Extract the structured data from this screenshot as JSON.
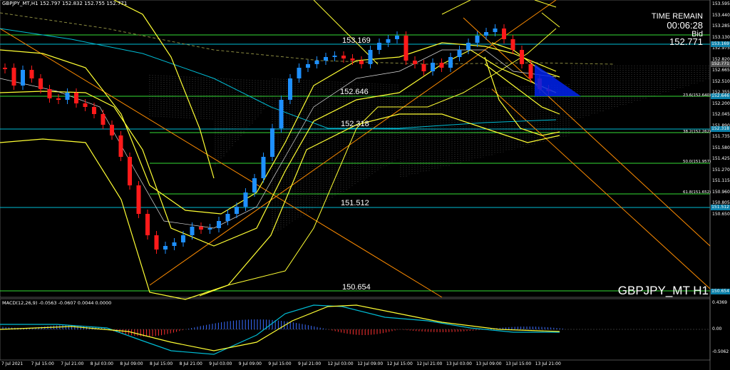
{
  "info_line": "GBPJPY_MT,H1  152.797 152.832 152.755 152.771",
  "macd_label": "MACD(12,26,9) -0.0563 -0.0607 0.0044 0.0000",
  "time_remain": {
    "label": "TIME REMAIN",
    "value": "00:06:28"
  },
  "bid": {
    "label": "Bid",
    "value": "152.771"
  },
  "symbol_label": "GBPJPY_MT H1",
  "levels": [
    "153.169",
    "152.646",
    "152.318",
    "151.512",
    "150.654"
  ],
  "fib_labels": [
    "23.6(152.640)",
    "38.2(152.262)",
    "50.0(151.957)",
    "61.8(151.652)"
  ],
  "price_ticks": [
    "153.595",
    "153.440",
    "153.285",
    "153.130",
    "152.975",
    "152.820",
    "152.665",
    "152.510",
    "152.355",
    "152.200",
    "152.045",
    "151.890",
    "151.735",
    "151.580",
    "151.425",
    "151.270",
    "151.115",
    "150.960",
    "150.805",
    "150.650"
  ],
  "macd_ticks": [
    "0.4369",
    "0.00",
    "-0.5062"
  ],
  "time_ticks": [
    "7 Jul 2021",
    "7 Jul 15:00",
    "7 Jul 21:00",
    "8 Jul 03:00",
    "8 Jul 09:00",
    "8 Jul 15:00",
    "8 Jul 21:00",
    "9 Jul 03:00",
    "9 Jul 09:00",
    "9 Jul 15:00",
    "9 Jul 21:00",
    "12 Jul 03:00",
    "12 Jul 09:00",
    "12 Jul 15:00",
    "12 Jul 21:00",
    "13 Jul 03:00",
    "13 Jul 09:00",
    "13 Jul 15:00",
    "13 Jul 21:00"
  ],
  "badges": {
    "bid": "152.771",
    "cyan_high": "153.169",
    "l152646": "152.646",
    "l152318": "152.318",
    "l151512": "151.512",
    "l150654": "150.654"
  },
  "colors": {
    "bull": "#1e90ff",
    "bear": "#ff1a1a",
    "ma_yellow": "#ffff33",
    "cyan": "#00bcd4",
    "orange": "#ff8c00",
    "level_green": "#33dd33"
  }
}
